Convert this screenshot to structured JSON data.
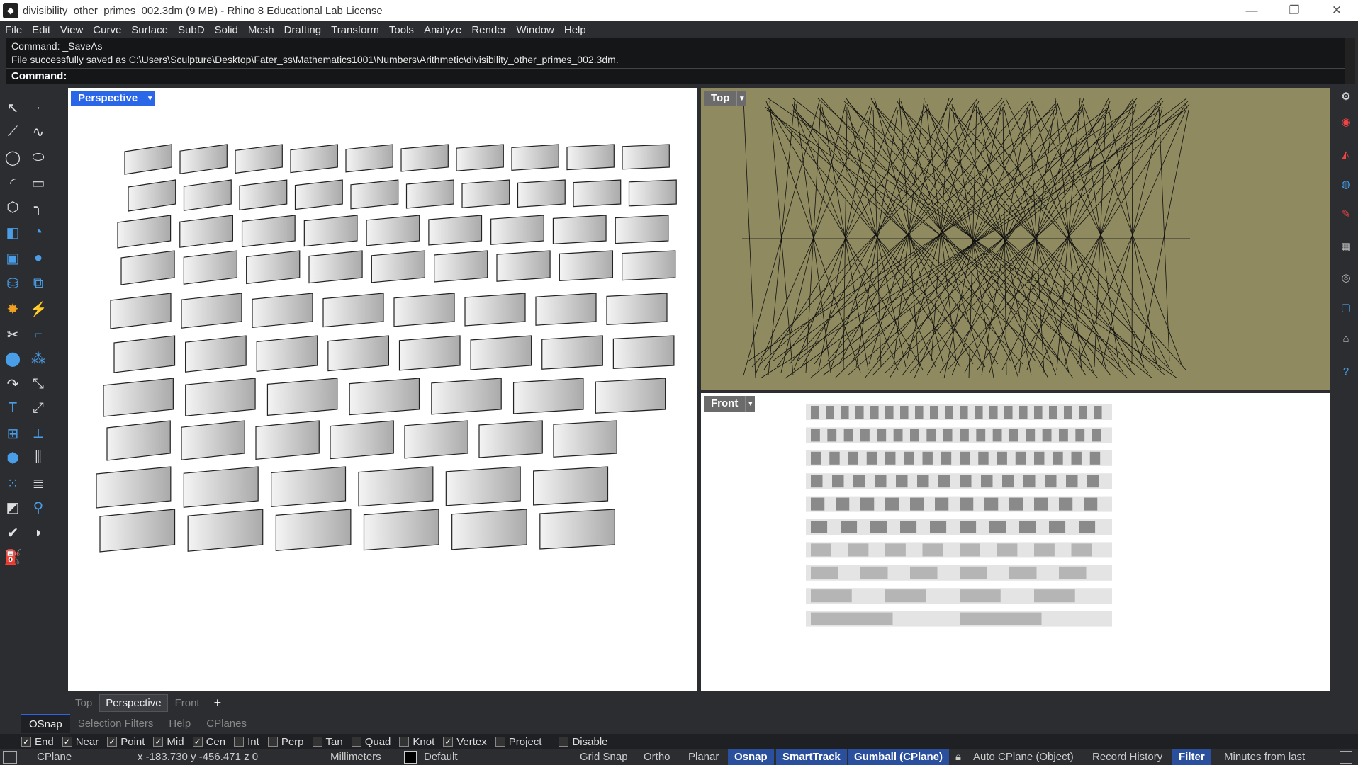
{
  "window": {
    "title": "divisibility_other_primes_002.3dm (9 MB) - Rhino 8 Educational Lab License"
  },
  "menu": [
    "File",
    "Edit",
    "View",
    "Curve",
    "Surface",
    "SubD",
    "Solid",
    "Mesh",
    "Drafting",
    "Transform",
    "Tools",
    "Analyze",
    "Render",
    "Window",
    "Help"
  ],
  "command_history": [
    "Command: _SaveAs",
    "File successfully saved as C:\\Users\\Sculpture\\Desktop\\Fater_ss\\Mathematics1001\\Numbers\\Arithmetic\\divisibility_other_primes_002.3dm."
  ],
  "command_prompt": "Command:",
  "viewports": {
    "perspective": "Perspective",
    "top": "Top",
    "front": "Front"
  },
  "viewport_tabs": [
    "Top",
    "Perspective",
    "Front"
  ],
  "panel_tabs": [
    "OSnap",
    "Selection Filters",
    "Help",
    "CPlanes"
  ],
  "osnaps": [
    {
      "label": "End",
      "checked": true
    },
    {
      "label": "Near",
      "checked": true
    },
    {
      "label": "Point",
      "checked": true
    },
    {
      "label": "Mid",
      "checked": true
    },
    {
      "label": "Cen",
      "checked": true
    },
    {
      "label": "Int",
      "checked": false
    },
    {
      "label": "Perp",
      "checked": false
    },
    {
      "label": "Tan",
      "checked": false
    },
    {
      "label": "Quad",
      "checked": false
    },
    {
      "label": "Knot",
      "checked": false
    },
    {
      "label": "Vertex",
      "checked": true
    },
    {
      "label": "Project",
      "checked": false
    },
    {
      "label": "Disable",
      "checked": false
    }
  ],
  "status": {
    "cplane": "CPlane",
    "coords": "x -183.730  y -456.471  z 0",
    "units": "Millimeters",
    "layer": "Default",
    "grid_snap": "Grid Snap",
    "ortho": "Ortho",
    "planar": "Planar",
    "osnap": "Osnap",
    "smarttrack": "SmartTrack",
    "gumball": "Gumball (CPlane)",
    "autocplane": "Auto CPlane (Object)",
    "record_history": "Record History",
    "filter": "Filter",
    "minutes": "Minutes from last"
  }
}
